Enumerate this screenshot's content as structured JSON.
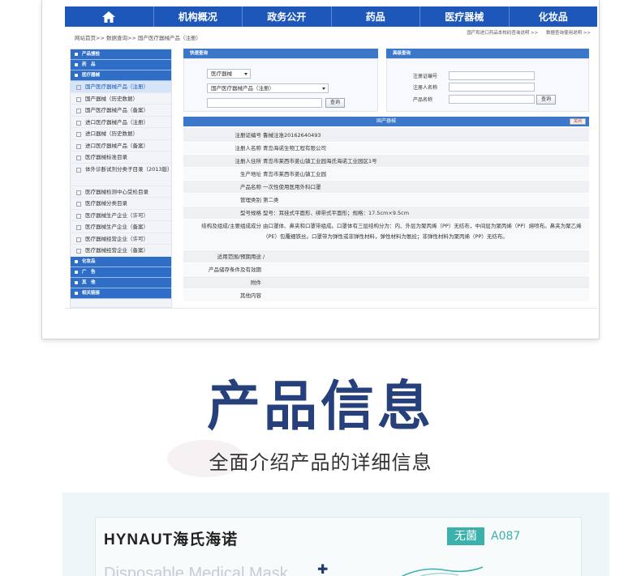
{
  "nav": {
    "items": [
      "机构概况",
      "政务公开",
      "药品",
      "医疗器械",
      "化妆品"
    ]
  },
  "breadcrumb": "网站首页>> 数据查询>> 国产医疗器械产品（注册）",
  "breadcrumb_home": "网站首页",
  "toplinks": [
    "国产和进口药品本校码查询说明 >>",
    "数据查询使用说明 >>"
  ],
  "sidebar": {
    "cat_products": "产品搜检",
    "cat_drugs": "药　品",
    "cat_devices": "医疗器械",
    "items": [
      "国产医疗器械产品（注册）",
      "国产器械（历史数据）",
      "国产医疗器械产品（备案）",
      "进口医疗器械产品（注册）",
      "进口器械（历史数据）",
      "进口医疗器械产品（备案）",
      "医疗器械标准目录",
      "体外诊断试剂分类子目录（2013版）",
      "医疗器械检测中心受检目录",
      "医疗器械分类目录",
      "医疗器械生产企业（许可）",
      "医疗器械生产企业（备案）",
      "医疗器械经营企业（许可）",
      "医疗器械经营企业（备案）"
    ],
    "cat_cosmetics": "化妆品",
    "cat_ads": "广　告",
    "cat_other": "其　他",
    "cat_links": "相关链接"
  },
  "quick_search": {
    "title": "快速查询",
    "category": "医疗器械",
    "subcategory": "国产医疗器械产品（注册）",
    "button": "查询"
  },
  "advanced_search": {
    "title": "高级查询",
    "labels": [
      "注册证编号",
      "注册人名称",
      "产品名称"
    ],
    "button": "查询"
  },
  "detail": {
    "title": "国产器械",
    "close": "关闭",
    "rows": [
      {
        "label": "注册证编号",
        "value": "鲁械注准20162640493"
      },
      {
        "label": "注册人名称",
        "value": "青岛海诺生物工程有限公司"
      },
      {
        "label": "注册人住所",
        "value": "青岛市莱西市姜山镇工业园海氏海诺工业园区1号"
      },
      {
        "label": "生产地址",
        "value": "青岛市莱西市姜山镇工业园"
      },
      {
        "label": "产品名称",
        "value": "一次性使用医用外科口罩"
      },
      {
        "label": "管理类别",
        "value": "第二类"
      },
      {
        "label": "型号规格",
        "value": "型号：耳挂式平面形、绑带式平面形；规格：17.5cm×9.5cm"
      },
      {
        "label": "结构及组成/主要组成成分",
        "value": "由口罩体、鼻夹和口罩带组成。口罩体有三层结构分为：内、外层为聚丙烯（PP）无纺布，中间层为聚丙烯（PP）熔喷布。鼻夹为聚乙烯（PE）包覆细铁丝。口罩带为弹性或非弹性材料，弹性材料为氨纶；非弹性材料为聚丙烯（PP）无纺布。"
      },
      {
        "label": "适用范围/预期用途",
        "value": "/"
      },
      {
        "label": "产品储存条件及有效期",
        "value": ""
      },
      {
        "label": "附件",
        "value": ""
      },
      {
        "label": "其他内容",
        "value": ""
      }
    ]
  },
  "hero": {
    "title": "产品信息",
    "subtitle": "全面介绍产品的详细信息"
  },
  "product": {
    "brand": "HYNAUT海氏海诺",
    "badge": "无菌",
    "code": "A087",
    "name_partial": "Disposable Medical Mask"
  },
  "colors": {
    "nav_blue": "#1c57b9",
    "title_navy": "#25407a",
    "teal": "#3bb1ab"
  }
}
